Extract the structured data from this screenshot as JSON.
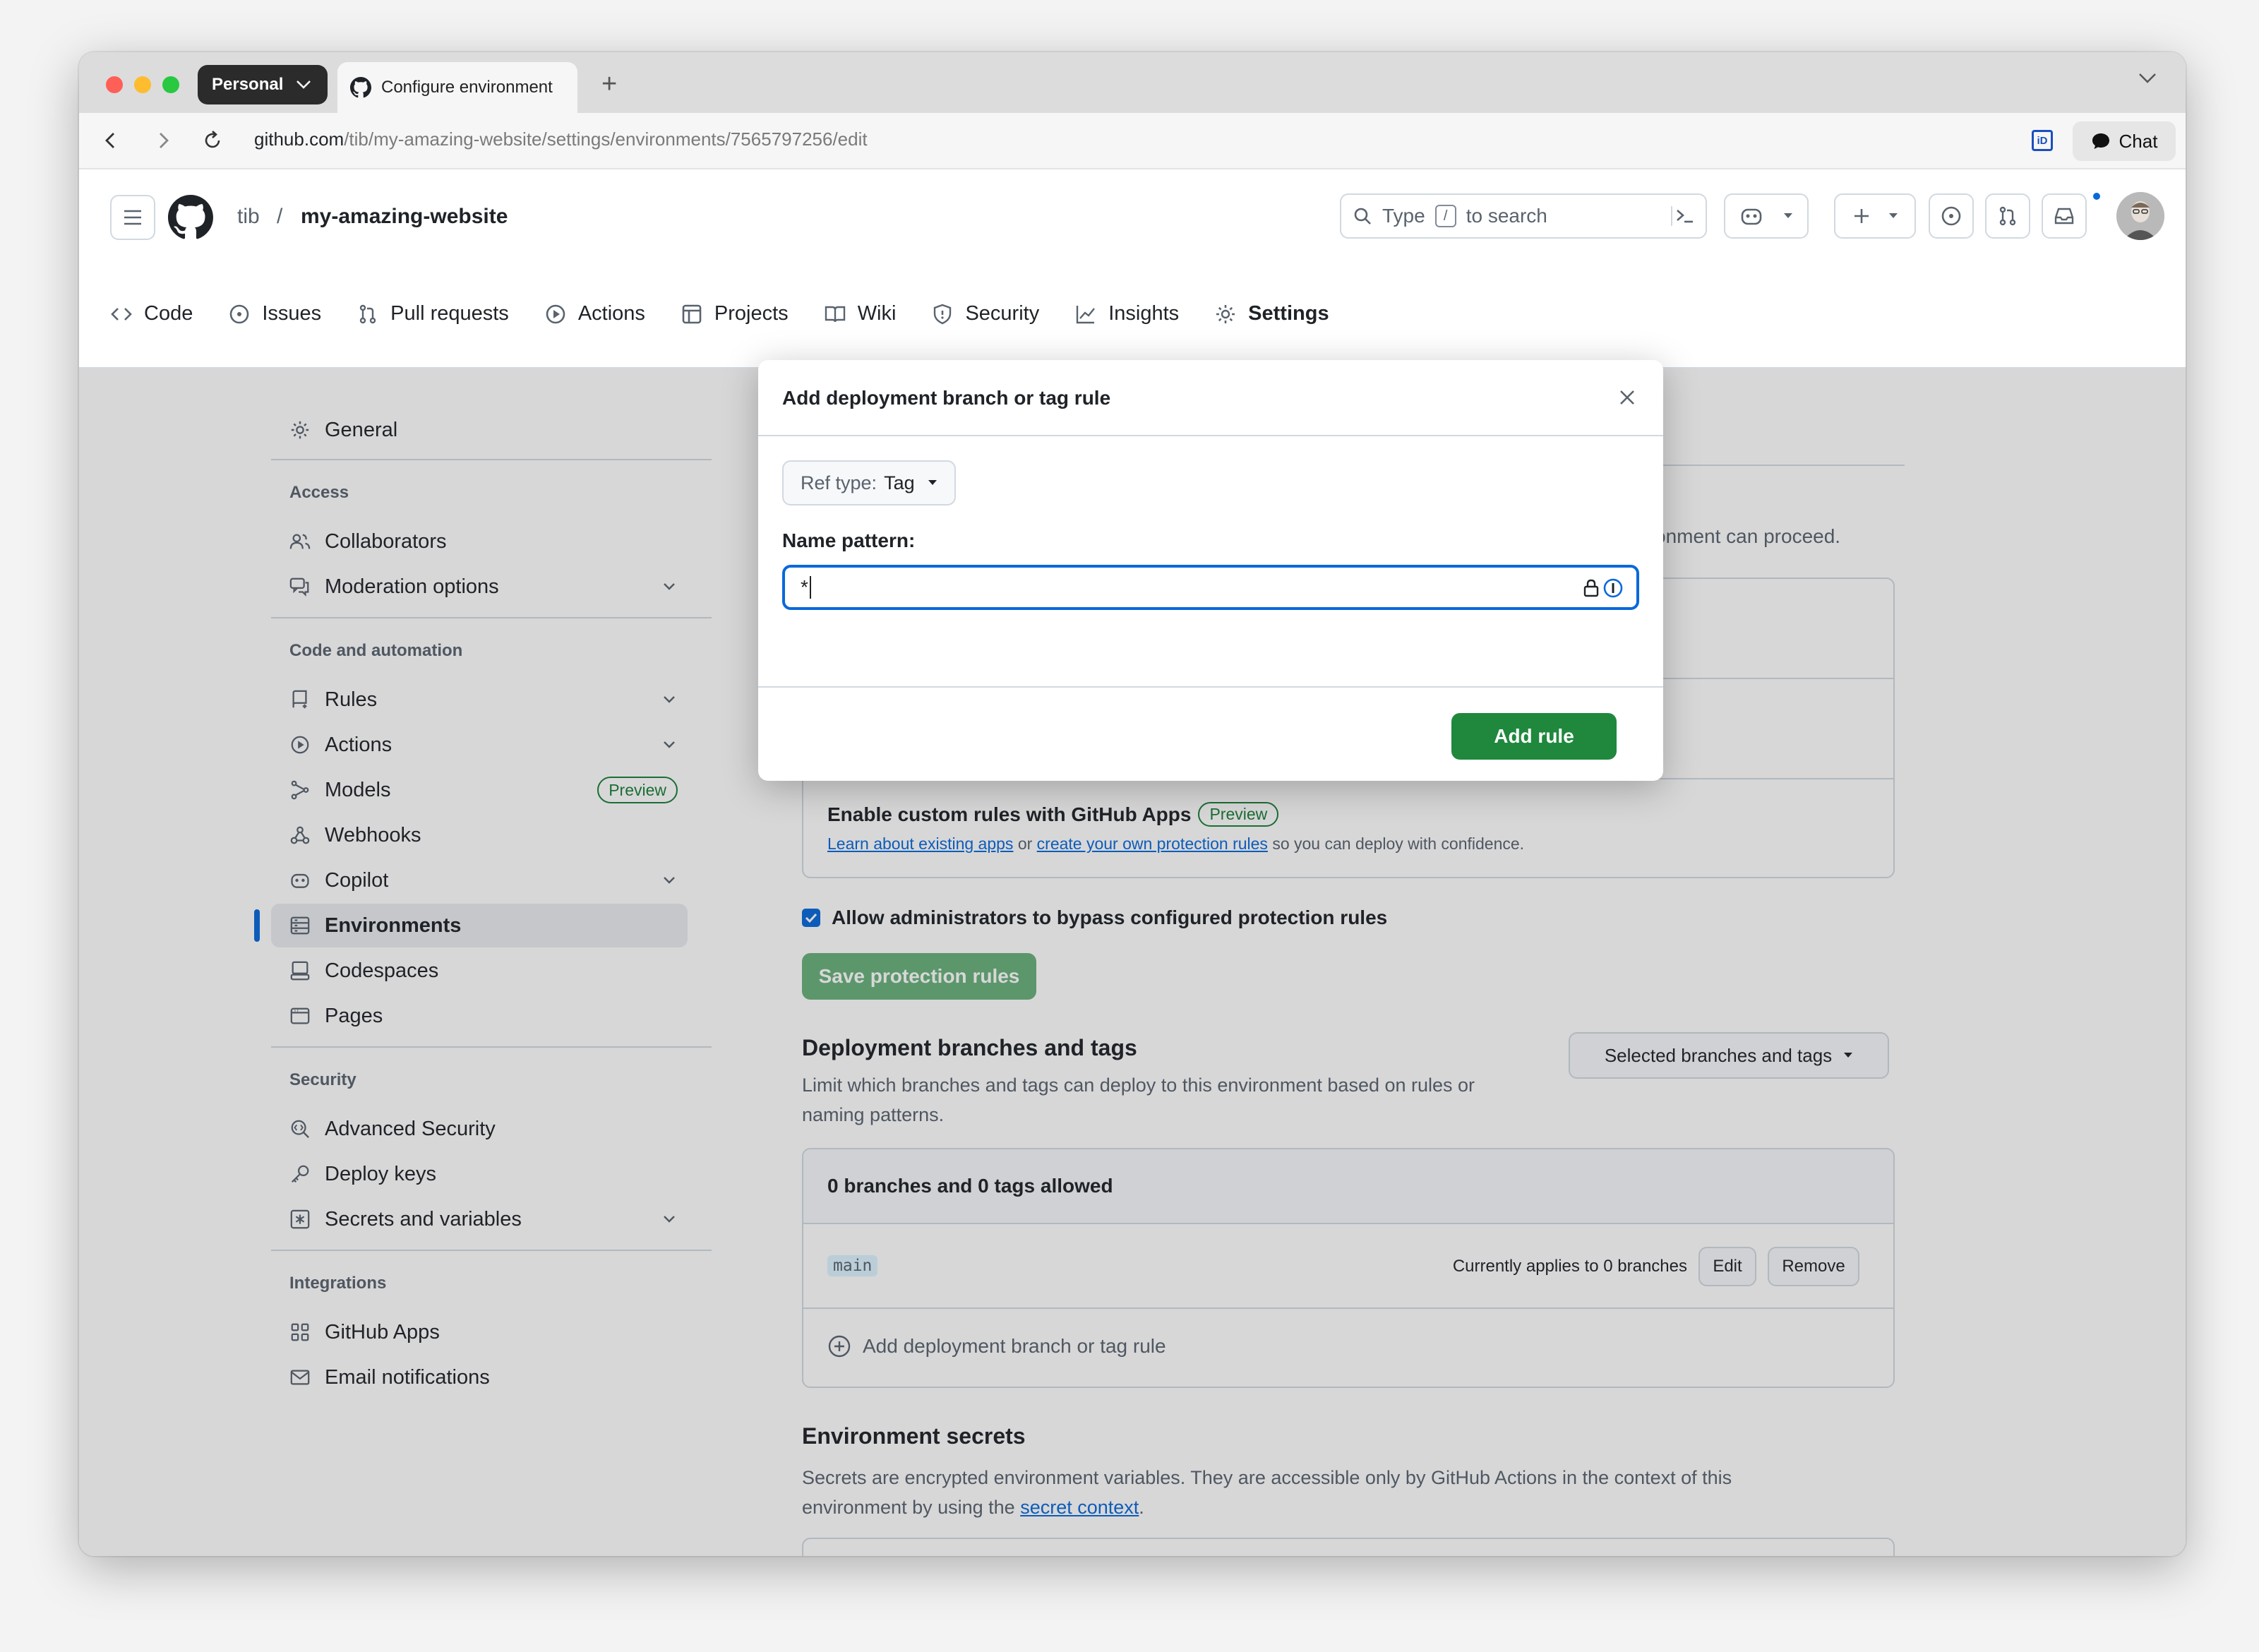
{
  "browser": {
    "profile": "Personal",
    "tab_title": "Configure environment",
    "url_host": "github.com",
    "url_path": "/tib/my-amazing-website/settings/environments/7565797256/edit",
    "chat_label": "Chat",
    "id_badge": "iD"
  },
  "header": {
    "owner": "tib",
    "separator": "/",
    "repo": "my-amazing-website",
    "search_pre": "Type",
    "search_key": "/",
    "search_post": "to search"
  },
  "reponav": [
    {
      "label": "Code"
    },
    {
      "label": "Issues"
    },
    {
      "label": "Pull requests"
    },
    {
      "label": "Actions"
    },
    {
      "label": "Projects"
    },
    {
      "label": "Wiki"
    },
    {
      "label": "Security"
    },
    {
      "label": "Insights"
    },
    {
      "label": "Settings"
    }
  ],
  "sidebar": {
    "general": "General",
    "access_heading": "Access",
    "collaborators": "Collaborators",
    "moderation": "Moderation options",
    "code_heading": "Code and automation",
    "rules": "Rules",
    "actions": "Actions",
    "models": "Models",
    "models_badge": "Preview",
    "webhooks": "Webhooks",
    "copilot": "Copilot",
    "environments": "Environments",
    "codespaces": "Codespaces",
    "pages": "Pages",
    "security_heading": "Security",
    "advanced_security": "Advanced Security",
    "deploy_keys": "Deploy keys",
    "secrets": "Secrets and variables",
    "integrations_heading": "Integrations",
    "github_apps": "GitHub Apps",
    "email_notifications": "Email notifications"
  },
  "main": {
    "proceed_fragment": "onment can proceed.",
    "custom_rules_title": "Enable custom rules with GitHub Apps",
    "custom_rules_badge": "Preview",
    "learn_link": "Learn about existing apps",
    "or_text": "or",
    "create_link": "create your own protection rules",
    "confidence_text": "so you can deploy with confidence.",
    "bypass_label": "Allow administrators to bypass configured protection rules",
    "bypass_checked": true,
    "save_button": "Save protection rules",
    "branches_title": "Deployment branches and tags",
    "branches_desc_1": "Limit which branches and tags can deploy to this environment based on rules or",
    "branches_desc_2": "naming patterns.",
    "branches_select": "Selected branches and tags",
    "allowed_summary": "0 branches and 0 tags allowed",
    "rule_name": "main",
    "rule_applies": "Currently applies to 0 branches",
    "edit_button": "Edit",
    "remove_button": "Remove",
    "add_rule_link": "Add deployment branch or tag rule",
    "secrets_title": "Environment secrets",
    "secrets_desc_1": "Secrets are encrypted environment variables. They are accessible only by GitHub Actions in the context of this",
    "secrets_desc_2": "environment by using the",
    "secret_context_link": "secret context",
    "secrets_desc_end": "."
  },
  "modal": {
    "title": "Add deployment branch or tag rule",
    "ref_type_label": "Ref type:",
    "ref_type_value": "Tag",
    "name_pattern_label": "Name pattern:",
    "name_pattern_value": "*",
    "add_rule_button": "Add rule"
  },
  "colors": {
    "accent": "#0969da",
    "primary_button": "#1f883d",
    "border": "#d1d9e0"
  }
}
